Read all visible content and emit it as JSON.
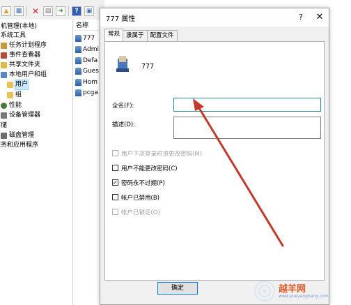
{
  "toolbar": {
    "icons": [
      "up-folder-icon",
      "properties-icon",
      "delete-icon",
      "export-list-icon",
      "forward-icon",
      "help-icon",
      "console-icon"
    ]
  },
  "tree": {
    "items": [
      {
        "label": "机管理(本地)"
      },
      {
        "label": "系统工具"
      },
      {
        "label": "任务计划程序"
      },
      {
        "label": "事件查看器"
      },
      {
        "label": "共享文件夹"
      },
      {
        "label": "本地用户和组"
      },
      {
        "label": "用户"
      },
      {
        "label": "组"
      },
      {
        "label": "性能"
      },
      {
        "label": "设备管理器"
      },
      {
        "label": "存储"
      },
      {
        "label": "磁盘管理"
      },
      {
        "label": "服务和应用程序"
      }
    ]
  },
  "list": {
    "header": "名称",
    "items": [
      "777",
      "Admi",
      "Defa",
      "Gues",
      "Hom",
      "pcga"
    ]
  },
  "dialog": {
    "title": "777 属性",
    "help": "?",
    "close": "✕",
    "tabs": [
      "常规",
      "隶属于",
      "配置文件"
    ],
    "username": "777",
    "fullname_label": "全名(F):",
    "fullname_value": "",
    "description_label": "描述(D):",
    "description_value": "",
    "checkboxes": [
      {
        "label": "用户下次登录时须更改密码(M)",
        "checked": false,
        "disabled": true
      },
      {
        "label": "用户不能更改密码(C)",
        "checked": false,
        "disabled": false
      },
      {
        "label": "密码永不过期(P)",
        "checked": true,
        "disabled": false
      },
      {
        "label": "帐户已禁用(B)",
        "checked": false,
        "disabled": false
      },
      {
        "label": "帐户已锁定(O)",
        "checked": false,
        "disabled": true
      }
    ],
    "ok_button": "确定"
  },
  "watermark": {
    "text": "越羊网",
    "url": "www.yueyangbang.com"
  },
  "colors": {
    "arrow": "#c0392b",
    "focus_border": "#2a8f9a",
    "selection": "#cce8ff"
  }
}
